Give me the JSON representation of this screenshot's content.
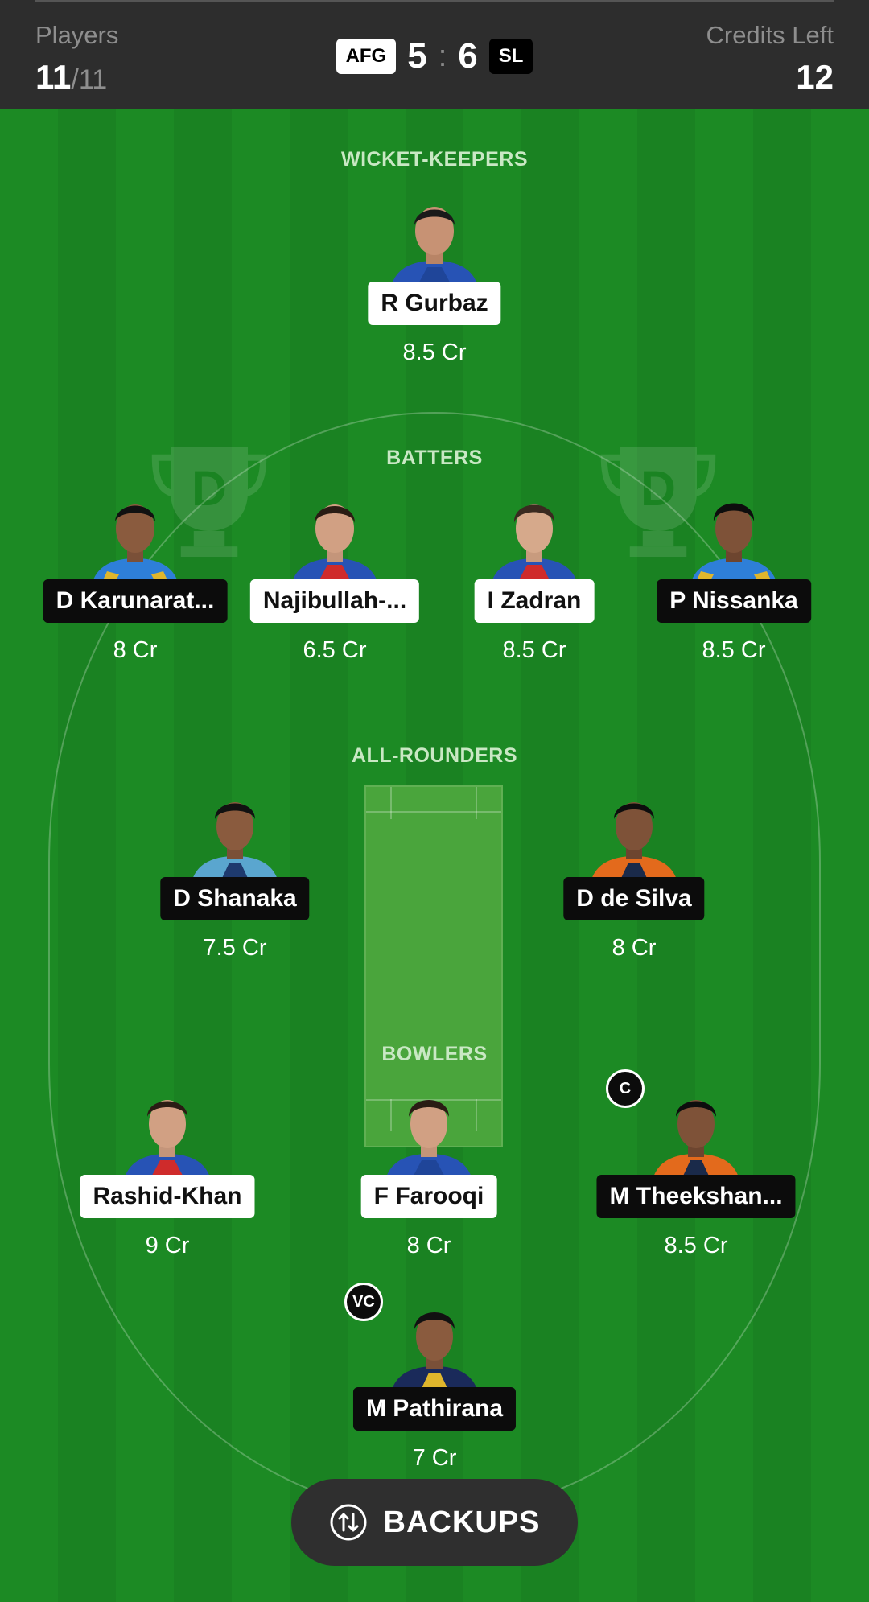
{
  "header": {
    "players_label": "Players",
    "players_selected": "11",
    "players_max": "/11",
    "credits_label": "Credits Left",
    "credits_left": "12",
    "team_a": "AFG",
    "team_a_count": "5",
    "separator": ":",
    "team_b_count": "6",
    "team_b": "SL"
  },
  "sections": {
    "wicket_keepers": "WICKET-KEEPERS",
    "batters": "BATTERS",
    "all_rounders": "ALL-ROUNDERS",
    "bowlers": "BOWLERS"
  },
  "players": {
    "gurbaz": {
      "name": "R Gurbaz",
      "credits": "8.5 Cr",
      "team": "AFG"
    },
    "karunaratne": {
      "name": "D Karunarat...",
      "credits": "8 Cr",
      "team": "SL"
    },
    "najibullah": {
      "name": "Najibullah-...",
      "credits": "6.5 Cr",
      "team": "AFG"
    },
    "zadran": {
      "name": "I Zadran",
      "credits": "8.5 Cr",
      "team": "AFG"
    },
    "nissanka": {
      "name": "P Nissanka",
      "credits": "8.5 Cr",
      "team": "SL"
    },
    "shanaka": {
      "name": "D Shanaka",
      "credits": "7.5 Cr",
      "team": "SL"
    },
    "desilva": {
      "name": "D de Silva",
      "credits": "8 Cr",
      "team": "SL"
    },
    "rashid": {
      "name": "Rashid-Khan",
      "credits": "9 Cr",
      "team": "AFG"
    },
    "farooqi": {
      "name": "F Farooqi",
      "credits": "8 Cr",
      "team": "AFG"
    },
    "theekshana": {
      "name": "M Theekshan...",
      "credits": "8.5 Cr",
      "team": "SL",
      "role": "C"
    },
    "pathirana": {
      "name": "M Pathirana",
      "credits": "7 Cr",
      "team": "SL",
      "role": "VC"
    }
  },
  "captain_badge": "C",
  "vice_captain_badge": "VC",
  "backups": {
    "label": "BACKUPS",
    "icon": "swap-arrows-icon"
  },
  "colors": {
    "field": "#1c8a24",
    "header": "#2d2d2d",
    "afg_tag": "#ffffff",
    "sl_tag": "#000000"
  }
}
